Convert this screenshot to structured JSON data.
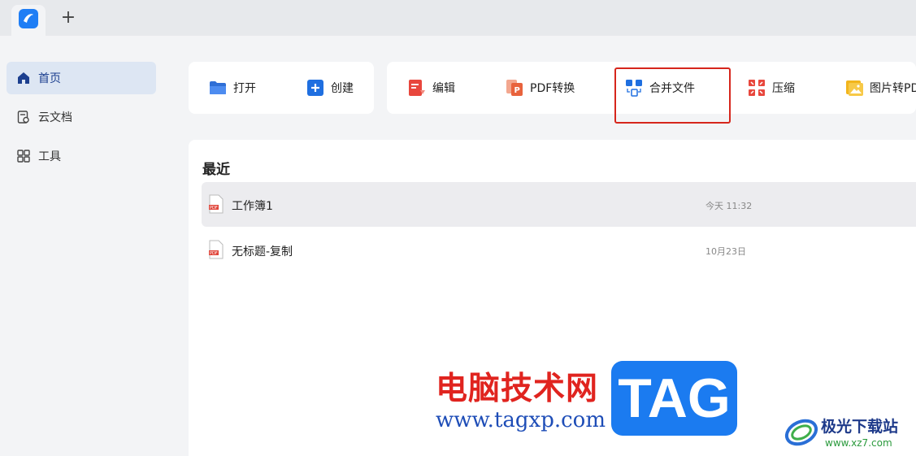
{
  "titlebar": {
    "new_tab_symbol": "+"
  },
  "sidebar": {
    "items": [
      {
        "label": "首页",
        "icon": "home-icon",
        "active": true
      },
      {
        "label": "云文档",
        "icon": "cloud-doc-icon",
        "active": false
      },
      {
        "label": "工具",
        "icon": "grid-tools-icon",
        "active": false
      }
    ]
  },
  "toolbar": {
    "open": "打开",
    "create": "创建",
    "edit": "编辑",
    "pdf_convert": "PDF转换",
    "merge": "合并文件",
    "compress": "压缩",
    "image_to_pdf": "图片转PDF"
  },
  "recent": {
    "title": "最近",
    "files": [
      {
        "name": "工作簿1",
        "time": "今天 11:32",
        "type": "PDF"
      },
      {
        "name": "无标题-复制",
        "time": "10月23日",
        "type": "PDF"
      }
    ]
  },
  "watermark": {
    "cn_text": "电脑技术网",
    "url": "www.tagxp.com",
    "tag": "TAG",
    "site_name": "极光下载站",
    "site_url": "www.xz7.com"
  },
  "colors": {
    "accent": "#1f7ef5",
    "highlight_border": "#d6261c",
    "pdf_red": "#e0453a"
  }
}
